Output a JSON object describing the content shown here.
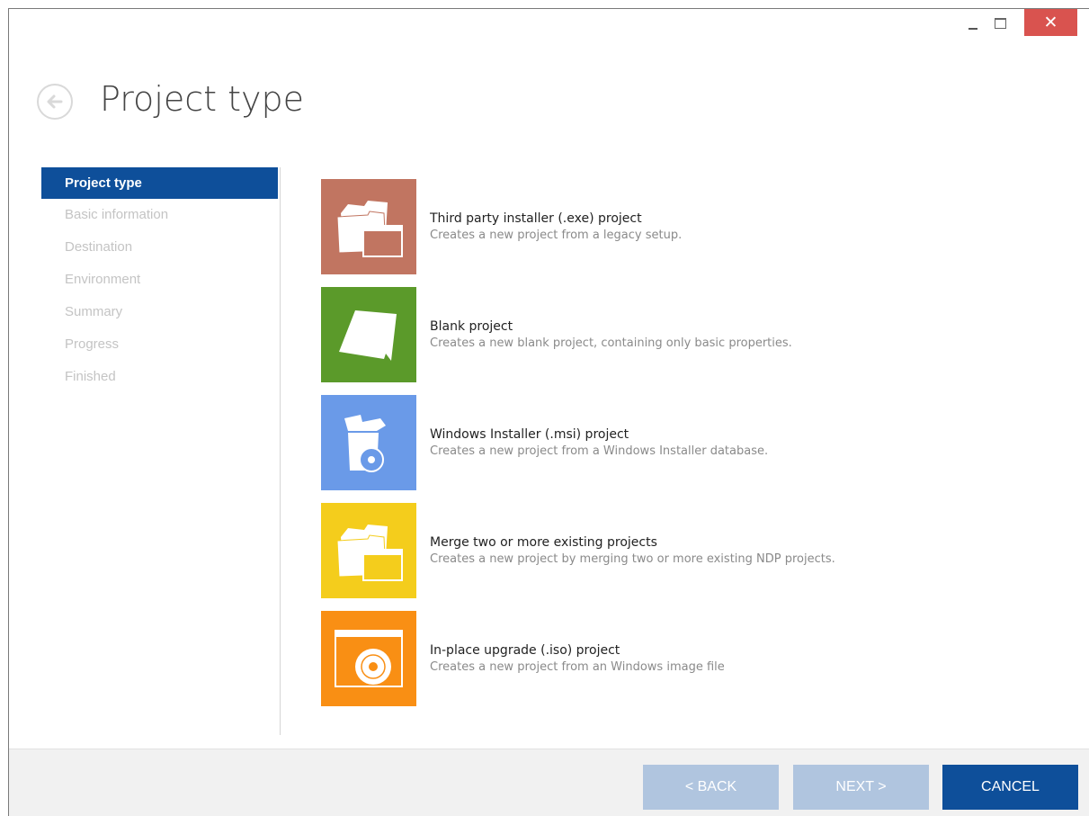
{
  "window": {
    "title": "Project type",
    "caption": {
      "minimize": "minimize-icon",
      "maximize": "maximize-icon",
      "close": "close-icon"
    }
  },
  "sidebar": {
    "steps": [
      {
        "label": "Project type",
        "active": true
      },
      {
        "label": "Basic information",
        "active": false
      },
      {
        "label": "Destination",
        "active": false
      },
      {
        "label": "Environment",
        "active": false
      },
      {
        "label": "Summary",
        "active": false
      },
      {
        "label": "Progress",
        "active": false
      },
      {
        "label": "Finished",
        "active": false
      }
    ]
  },
  "options": [
    {
      "title": "Third party installer (.exe) project",
      "description": "Creates a new project from a legacy setup.",
      "color": "#c17561",
      "icon": "folder-window-icon"
    },
    {
      "title": "Blank project",
      "description": "Creates a new blank project, containing only basic properties.",
      "color": "#5b9a2a",
      "icon": "blank-page-icon"
    },
    {
      "title": "Windows Installer (.msi) project",
      "description": "Creates a new project from a Windows Installer database.",
      "color": "#6a9ae8",
      "icon": "installer-box-icon"
    },
    {
      "title": "Merge two or more existing projects",
      "description": "Creates a new project by merging two or more existing NDP projects.",
      "color": "#f4cd1c",
      "icon": "merge-folders-icon"
    },
    {
      "title": "In-place upgrade (.iso) project",
      "description": "Creates a new project from an Windows image file",
      "color": "#f98f14",
      "icon": "disc-window-icon"
    }
  ],
  "footer": {
    "back_label": "< BACK",
    "next_label": "NEXT >",
    "cancel_label": "CANCEL"
  },
  "colors": {
    "accent": "#0e4f9a",
    "disabled_button": "#b0c5df",
    "close": "#d9534f"
  }
}
